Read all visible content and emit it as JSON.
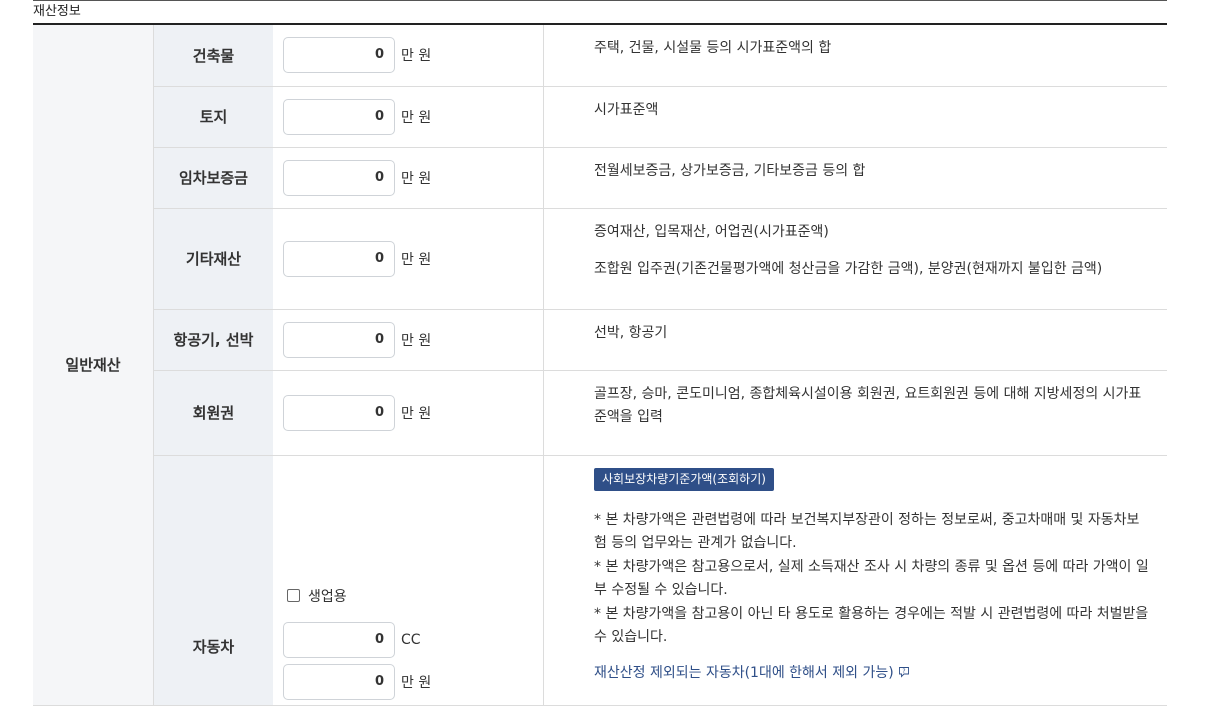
{
  "section_title": "재산정보",
  "category": "일반재산",
  "rows": [
    {
      "label": "건축물",
      "value": "0",
      "unit": "만 원",
      "desc": [
        "주택, 건물, 시설물 등의 시가표준액의 합"
      ]
    },
    {
      "label": "토지",
      "value": "0",
      "unit": "만 원",
      "desc": [
        "시가표준액"
      ]
    },
    {
      "label": "임차보증금",
      "value": "0",
      "unit": "만 원",
      "desc": [
        "전월세보증금, 상가보증금, 기타보증금 등의 합"
      ]
    },
    {
      "label": "기타재산",
      "value": "0",
      "unit": "만 원",
      "desc": [
        "증여재산, 입목재산, 어업권(시가표준액)",
        "조합원 입주권(기존건물평가액에 청산금을 가감한 금액), 분양권(현재까지 불입한 금액)"
      ]
    },
    {
      "label": "항공기, 선박",
      "value": "0",
      "unit": "만 원",
      "desc": [
        "선박, 항공기"
      ]
    },
    {
      "label": "회원권",
      "value": "0",
      "unit": "만 원",
      "desc": [
        "골프장, 승마, 콘도미니엄, 종합체육시설이용 회원권, 요트회원권 등에 대해 지방세정의 시가표준액을 입력"
      ]
    }
  ],
  "car": {
    "label": "자동차",
    "business_checkbox_label": "생업용",
    "cc_value": "0",
    "cc_unit": "CC",
    "price_value": "0",
    "price_unit": "만 원",
    "lookup_button": "사회보장차량기준가액(조회하기)",
    "notes": [
      "* 본 차량가액은 관련법령에 따라 보건복지부장관이 정하는 정보로써, 중고차매매 및 자동차보험 등의 업무와는 관계가 없습니다.",
      "* 본 차량가액은 참고용으로서, 실제 소득재산 조사 시 차량의 종류 및 옵션 등에 따라 가액이 일부 수정될 수 있습니다.",
      "* 본 차량가액을 참고용이 아닌 타 용도로 활용하는 경우에는 적발 시 관련법령에 따라 처벌받을 수 있습니다."
    ],
    "exclusion_link": "재산산정 제외되는 자동차(1대에 한해서 제외 가능)",
    "help_icon": "speech-bubble-help-icon"
  },
  "colors": {
    "lookup_button_bg": "#2f4f88",
    "link": "#2f4f88",
    "label_bg": "#eef1f5"
  }
}
